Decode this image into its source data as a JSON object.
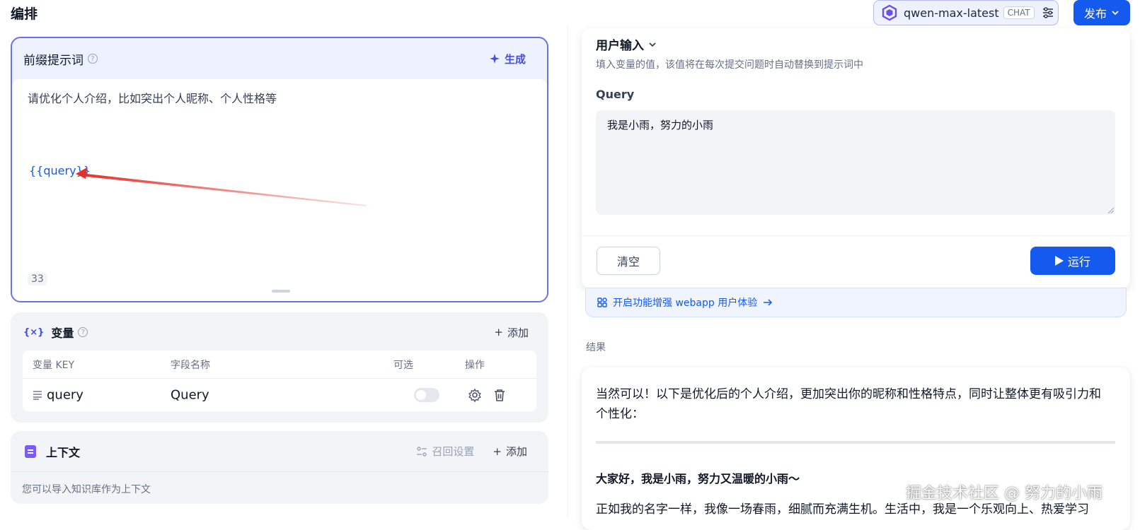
{
  "header": {
    "title": "编排"
  },
  "model": {
    "name": "qwen-max-latest",
    "badge": "CHAT"
  },
  "publish": {
    "label": "发布"
  },
  "prompt": {
    "title": "前缀提示词",
    "generate_label": "生成",
    "text": "请优化个人介绍，比如突出个人昵称、个人性格等",
    "variable": "{{query}}",
    "char_count": "33"
  },
  "variables": {
    "title": "变量",
    "add_label": "添加",
    "columns": [
      "变量 KEY",
      "字段名称",
      "可选",
      "操作"
    ],
    "rows": [
      {
        "key": "query",
        "name": "Query",
        "optional": false
      }
    ]
  },
  "context": {
    "title": "上下文",
    "recall_label": "召回设置",
    "add_label": "添加",
    "description": "您可以导入知识库作为上下文"
  },
  "user_input": {
    "title": "用户输入",
    "description": "填入变量的值，该值将在每次提交问题时自动替换到提示词中",
    "query_label": "Query",
    "query_value": "我是小雨，努力的小雨",
    "clear_label": "清空",
    "run_label": "运行"
  },
  "feature_banner": {
    "text": "开启功能增强 webapp 用户体验"
  },
  "result": {
    "label": "结果",
    "paragraph1": "当然可以！以下是优化后的个人介绍，更加突出你的昵称和性格特点，同时让整体更有吸引力和个性化：",
    "heading": "大家好，我是小雨，努力又温暖的小雨～",
    "paragraph2": "正如我的名字一样，我像一场春雨，细腻而充满生机。生活中，我是一个乐观向上、热爱学习"
  },
  "watermark": "掘金技术社区 @ 努力的小雨",
  "colors": {
    "accent": "#155aef",
    "indigo": "#444ce7",
    "arrow": "#e5302a"
  }
}
